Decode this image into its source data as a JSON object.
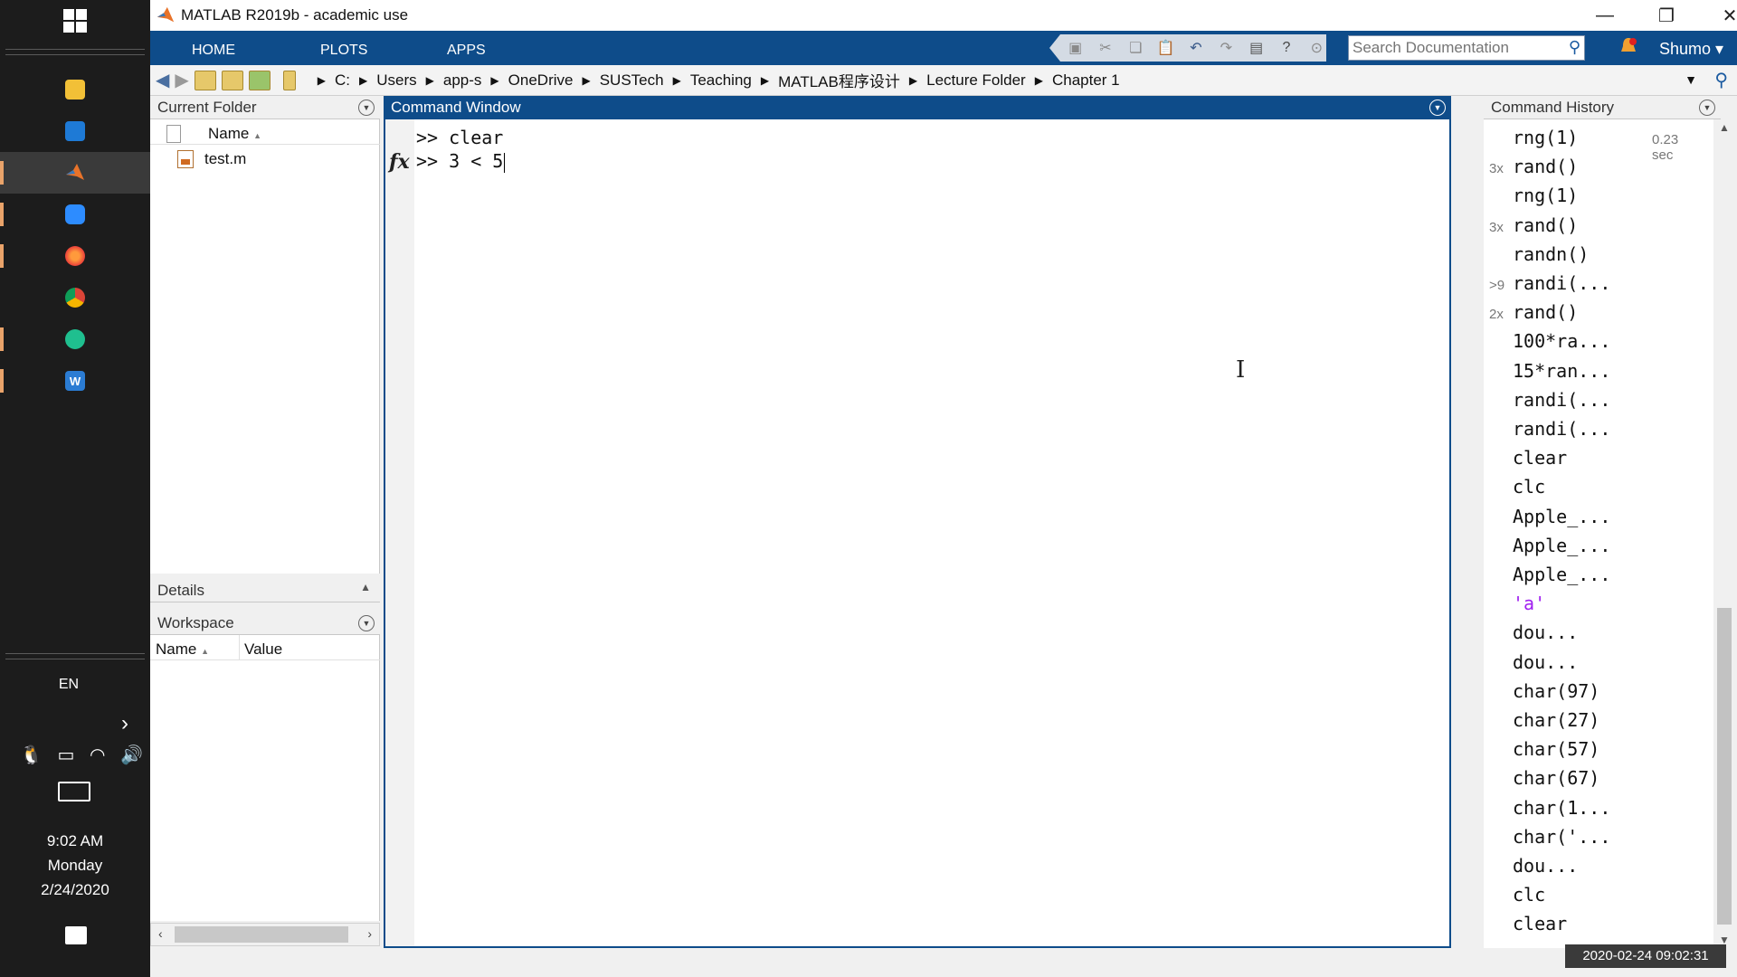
{
  "taskbar": {
    "apps": [
      "file-explorer",
      "recycle-bin",
      "matlab",
      "zoom",
      "firefox",
      "chrome",
      "notes",
      "word"
    ],
    "lang": "EN",
    "time": "9:02 AM",
    "day": "Monday",
    "date": "2/24/2020"
  },
  "window": {
    "title": "MATLAB R2019b - academic use"
  },
  "ribbon": {
    "tabs": [
      "HOME",
      "PLOTS",
      "APPS"
    ],
    "search_placeholder": "Search Documentation",
    "user": "Shumo"
  },
  "address": {
    "crumbs": [
      "C:",
      "Users",
      "app-s",
      "OneDrive",
      "SUSTech",
      "Teaching",
      "MATLAB程序设计",
      "Lecture Folder",
      "Chapter 1"
    ]
  },
  "current_folder": {
    "title": "Current Folder",
    "col_name": "Name",
    "files": [
      "test.m"
    ]
  },
  "details": {
    "title": "Details"
  },
  "workspace": {
    "title": "Workspace",
    "col_name": "Name",
    "col_value": "Value"
  },
  "command_window": {
    "title": "Command Window",
    "lines": [
      ">> clear",
      ">> 3 < 5"
    ]
  },
  "command_history": {
    "title": "Command History",
    "entries": [
      {
        "count": "",
        "cmd": "rng(1)",
        "time": "0.23 sec"
      },
      {
        "count": "3x",
        "cmd": "rand()",
        "time": ""
      },
      {
        "count": "",
        "cmd": "rng(1)",
        "time": ""
      },
      {
        "count": "3x",
        "cmd": "rand()",
        "time": ""
      },
      {
        "count": "",
        "cmd": "randn()",
        "time": ""
      },
      {
        "count": ">9",
        "cmd": "randi(...",
        "time": ""
      },
      {
        "count": "2x",
        "cmd": "rand()",
        "time": ""
      },
      {
        "count": "",
        "cmd": "100*ra...",
        "time": ""
      },
      {
        "count": "",
        "cmd": "15*ran...",
        "time": ""
      },
      {
        "count": "",
        "cmd": "randi(...",
        "time": ""
      },
      {
        "count": "",
        "cmd": "randi(...",
        "time": ""
      },
      {
        "count": "",
        "cmd": "clear",
        "time": ""
      },
      {
        "count": "",
        "cmd": "clc",
        "time": ""
      },
      {
        "count": "",
        "cmd": "Apple_...",
        "time": ""
      },
      {
        "count": "",
        "cmd": "Apple_...",
        "time": ""
      },
      {
        "count": "",
        "cmd": "Apple_...",
        "time": ""
      },
      {
        "count": "",
        "cmd": "'a'",
        "time": ""
      },
      {
        "count": "",
        "cmd": "dou...",
        "time": ""
      },
      {
        "count": "",
        "cmd": "dou...",
        "time": ""
      },
      {
        "count": "",
        "cmd": "char(97)",
        "time": ""
      },
      {
        "count": "",
        "cmd": "char(27)",
        "time": ""
      },
      {
        "count": "",
        "cmd": "char(57)",
        "time": ""
      },
      {
        "count": "",
        "cmd": "char(67)",
        "time": ""
      },
      {
        "count": "",
        "cmd": "char(1...",
        "time": ""
      },
      {
        "count": "",
        "cmd": "char('...",
        "time": ""
      },
      {
        "count": "",
        "cmd": "dou...",
        "time": ""
      },
      {
        "count": "",
        "cmd": "clc",
        "time": ""
      },
      {
        "count": "",
        "cmd": "clear",
        "time": ""
      }
    ]
  },
  "overlay_timestamp": "2020-02-24  09:02:31",
  "colors": {
    "ribbon_blue": "#0e4c8a",
    "string_purple": "#a020f0"
  }
}
